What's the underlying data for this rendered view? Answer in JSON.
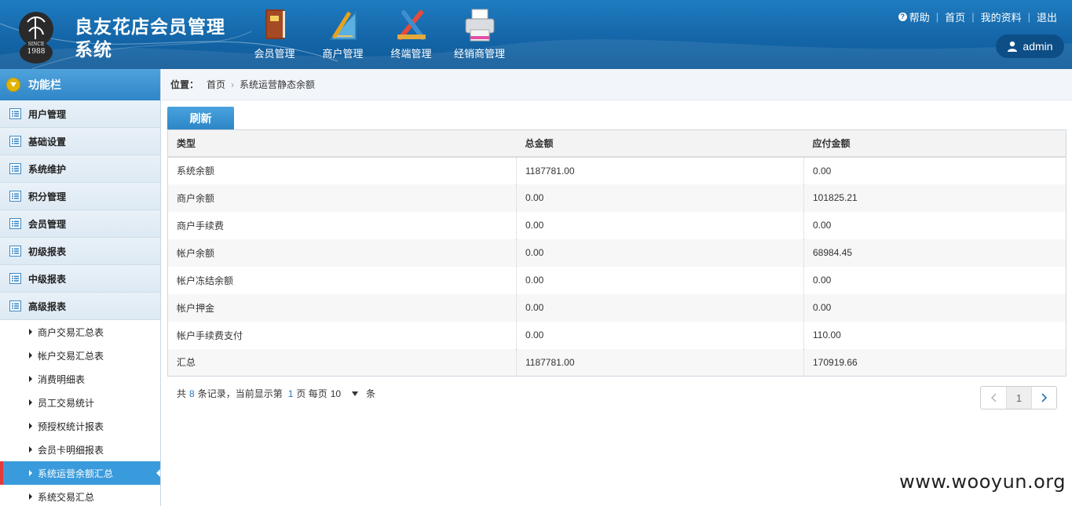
{
  "header": {
    "title": "良友花店会员管理系统",
    "logo_text": "SINCE 1988",
    "nav": [
      {
        "label": "会员管理",
        "icon": "book-icon"
      },
      {
        "label": "商户管理",
        "icon": "ruler-icon"
      },
      {
        "label": "终端管理",
        "icon": "tools-icon"
      },
      {
        "label": "经销商管理",
        "icon": "printer-icon"
      }
    ],
    "links": {
      "help": "帮助",
      "home": "首页",
      "profile": "我的资料",
      "logout": "退出"
    },
    "user": "admin"
  },
  "sidebar": {
    "title": "功能栏",
    "menu": [
      "用户管理",
      "基础设置",
      "系统维护",
      "积分管理",
      "会员管理",
      "初级报表",
      "中级报表",
      "高级报表"
    ],
    "sub": [
      "商户交易汇总表",
      "帐户交易汇总表",
      "消费明细表",
      "员工交易统计",
      "预授权统计报表",
      "会员卡明细报表",
      "系统运营余额汇总",
      "系统交易汇总"
    ],
    "active_sub": "系统运营余额汇总"
  },
  "breadcrumb": {
    "label": "位置：",
    "home": "首页",
    "current": "系统运营静态余额"
  },
  "toolbar": {
    "refresh": "刷新"
  },
  "table": {
    "headers": [
      "类型",
      "总金额",
      "应付金额"
    ],
    "rows": [
      [
        "系统余额",
        "1187781.00",
        "0.00"
      ],
      [
        "商户余额",
        "0.00",
        "101825.21"
      ],
      [
        "商户手续费",
        "0.00",
        "0.00"
      ],
      [
        "帐户余额",
        "0.00",
        "68984.45"
      ],
      [
        "帐户冻结余额",
        "0.00",
        "0.00"
      ],
      [
        "帐户押金",
        "0.00",
        "0.00"
      ],
      [
        "帐户手续费支付",
        "0.00",
        "110.00"
      ],
      [
        "汇总",
        "1187781.00",
        "170919.66"
      ]
    ]
  },
  "pager": {
    "prefix": "共",
    "total": "8",
    "mid": "条记录，当前显示第",
    "page": "1",
    "per_label": "页 每页",
    "per": "10",
    "suffix": "条",
    "current": "1"
  },
  "watermark": "www.wooyun.org"
}
